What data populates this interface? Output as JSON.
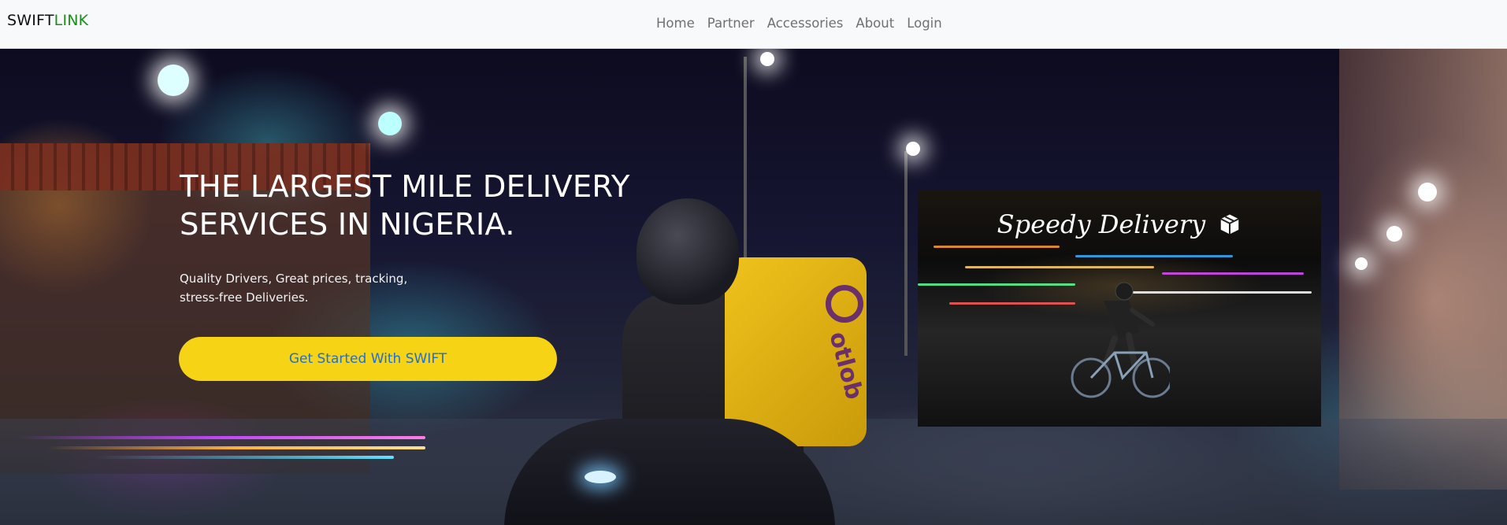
{
  "navbar": {
    "brand_part1": "SWIFT",
    "brand_part2": "LINK",
    "links": [
      "Home",
      "Partner",
      "Accessories",
      "About",
      "Login"
    ]
  },
  "hero": {
    "title_line1": "THE LARGEST MILE DELIVERY",
    "title_line2": "SERVICES IN NIGERIA.",
    "subtitle_line1": "Quality Drivers, Great prices, tracking,",
    "subtitle_line2": "stress-free Deliveries.",
    "cta_label": "Get Started With SWIFT",
    "bag_brand": "otlob"
  },
  "card": {
    "title": "Speedy Delivery",
    "icon": "package-icon"
  },
  "colors": {
    "brand_dark": "#111111",
    "brand_green": "#1a8f1a",
    "cta_bg": "#f6d314",
    "cta_text": "#1f6fd1",
    "nav_bg": "#f8f9fa"
  }
}
